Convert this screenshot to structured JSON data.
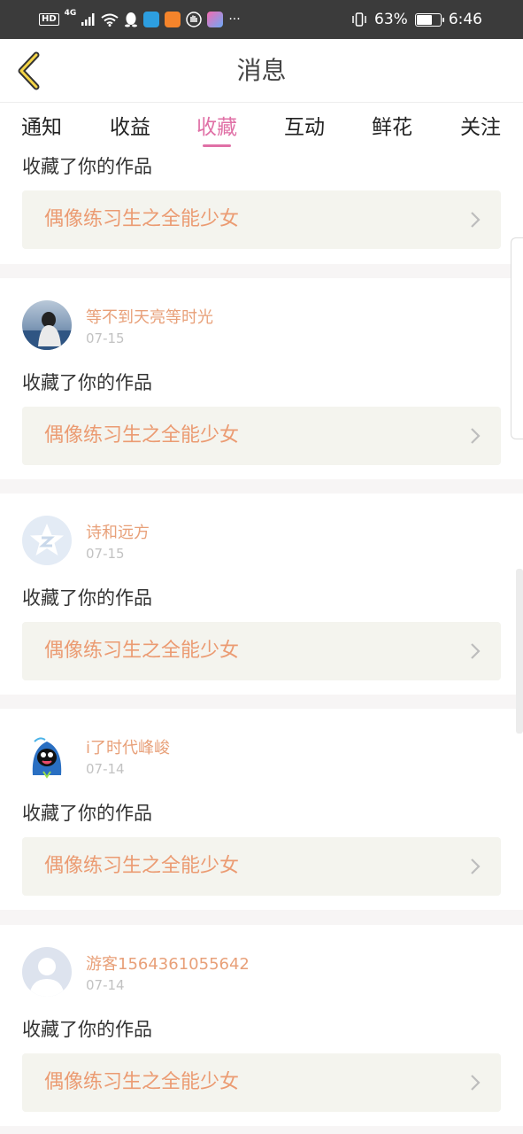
{
  "status_bar": {
    "hd": "HD",
    "network": "4G",
    "battery": "63%",
    "battery_level": 0.63,
    "time": "6:46",
    "more": "···"
  },
  "header": {
    "title": "消息",
    "back_icon": "chevron-left-icon"
  },
  "tabs": [
    {
      "label": "通知",
      "active": false
    },
    {
      "label": "收益",
      "active": false
    },
    {
      "label": "收藏",
      "active": true
    },
    {
      "label": "互动",
      "active": false
    },
    {
      "label": "鲜花",
      "active": false
    },
    {
      "label": "关注",
      "active": false
    }
  ],
  "colors": {
    "accent": "#e070a6",
    "username": "#e8a079",
    "work_title": "#eb9b72",
    "work_box_bg": "#f4f4ee"
  },
  "items": [
    {
      "username": "",
      "date": "",
      "action": "收藏了你的作品",
      "work_title": "偶像练习生之全能少女"
    },
    {
      "username": "等不到天亮等时光",
      "date": "07-15",
      "action": "收藏了你的作品",
      "work_title": "偶像练习生之全能少女",
      "avatar": "photo-avatar"
    },
    {
      "username": "诗和远方",
      "date": "07-15",
      "action": "收藏了你的作品",
      "work_title": "偶像练习生之全能少女",
      "avatar": "default-star-avatar"
    },
    {
      "username": "i了时代峰峻",
      "date": "07-14",
      "action": "收藏了你的作品",
      "work_title": "偶像练习生之全能少女",
      "avatar": "cartoon-avatar"
    },
    {
      "username": "游客1564361055642",
      "date": "07-14",
      "action": "收藏了你的作品",
      "work_title": "偶像练习生之全能少女",
      "avatar": "guest-avatar"
    }
  ]
}
